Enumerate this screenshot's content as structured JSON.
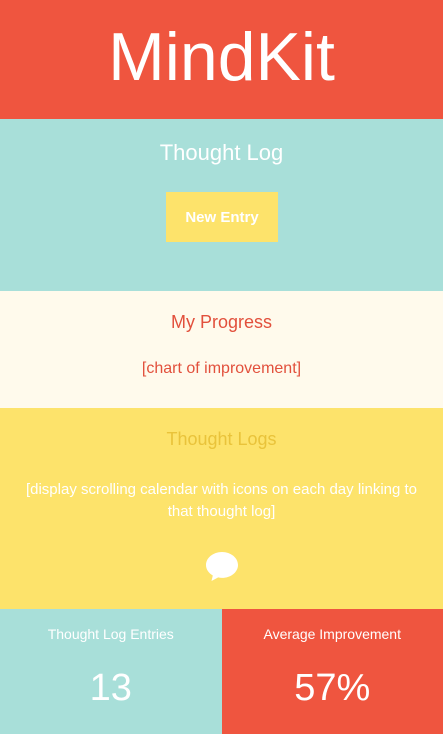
{
  "app": {
    "title": "MindKit"
  },
  "thought_log": {
    "heading": "Thought Log",
    "new_entry_label": "New Entry"
  },
  "progress": {
    "heading": "My Progress",
    "chart_placeholder": "[chart of improvement]"
  },
  "thought_logs": {
    "heading": "Thought Logs",
    "description": "[display scrolling calendar with icons on each day linking to that thought log]",
    "icon": "chat-bubble-icon"
  },
  "stats": {
    "entries_label": "Thought Log Entries",
    "entries_value": "13",
    "improvement_label": "Average Improvement",
    "improvement_value": "57%"
  },
  "colors": {
    "red": "#ef553f",
    "teal": "#a8dfd9",
    "yellow": "#fde36b",
    "cream": "#fffaec",
    "mustard": "#e9c33a"
  }
}
